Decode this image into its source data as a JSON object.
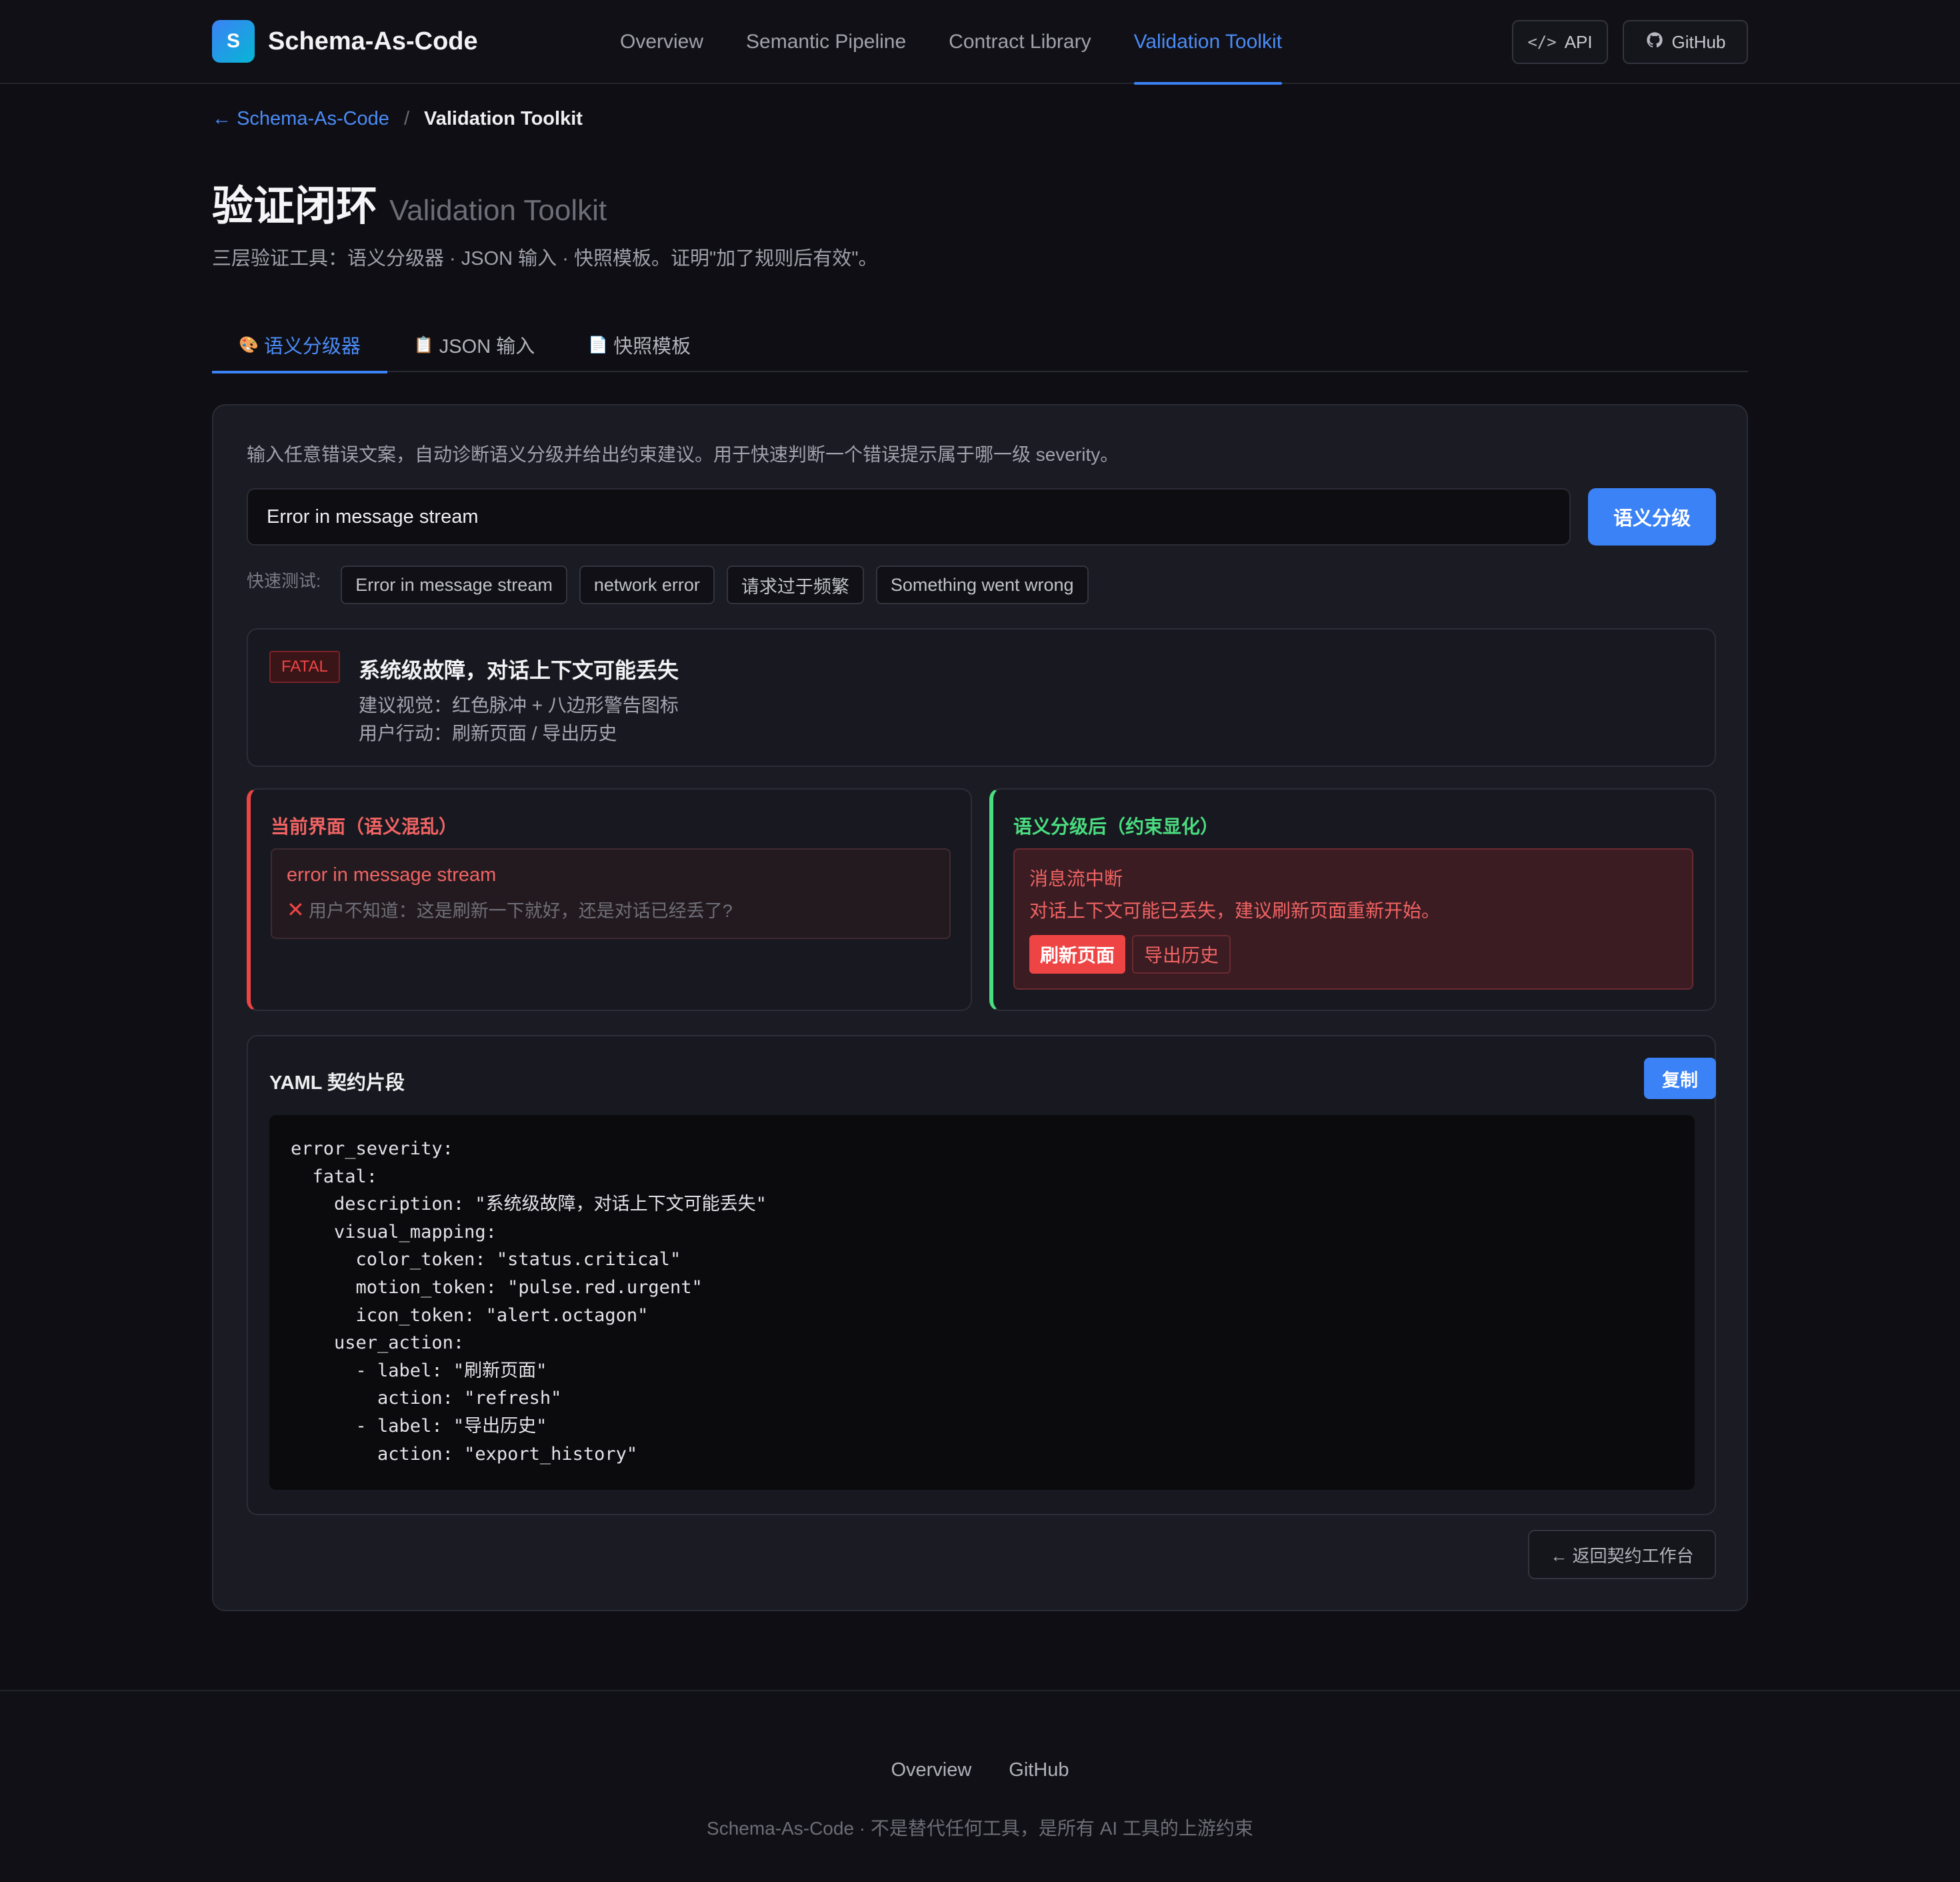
{
  "header": {
    "logo_letter": "S",
    "brand": "Schema-As-Code",
    "nav": [
      "Overview",
      "Semantic Pipeline",
      "Contract Library",
      "Validation Toolkit"
    ],
    "active_nav": "Validation Toolkit",
    "api_label": "API",
    "github_label": "GitHub",
    "api_icon": "code-icon",
    "github_icon": "github-icon"
  },
  "breadcrumb": {
    "back_arrow": "←",
    "back_label": "Schema-As-Code",
    "separator": "/",
    "current": "Validation Toolkit"
  },
  "page": {
    "title_zh": "验证闭环",
    "title_en": "Validation Toolkit",
    "subtitle": "三层验证工具：语义分级器 · JSON 输入 · 快照模板。证明\"加了规则后有效\"。"
  },
  "tabs": [
    {
      "icon": "🎨",
      "label": "语义分级器"
    },
    {
      "icon": "📋",
      "label": "JSON 输入"
    },
    {
      "icon": "📄",
      "label": "快照模板"
    }
  ],
  "classifier": {
    "description": "输入任意错误文案，自动诊断语义分级并给出约束建议。用于快速判断一个错误提示属于哪一级 severity。",
    "input_value": "Error in message stream",
    "submit_label": "语义分级",
    "quick_label": "快速测试:",
    "quick_tests": [
      "Error in message stream",
      "network error",
      "请求过于频繁",
      "Something went wrong"
    ]
  },
  "result": {
    "badge": "FATAL",
    "title": "系统级故障，对话上下文可能丢失",
    "visual": "建议视觉：红色脉冲 + 八边形警告图标",
    "action": "用户行动：刷新页面 / 导出历史"
  },
  "compare": {
    "before_title": "当前界面（语义混乱）",
    "before_error": "error in message stream",
    "before_mark": "✕",
    "before_note": "用户不知道：这是刷新一下就好，还是对话已经丢了?",
    "after_title": "语义分级后（约束显化）",
    "after_heading": "消息流中断",
    "after_desc": "对话上下文可能已丢失，建议刷新页面重新开始。",
    "after_btn_primary": "刷新页面",
    "after_btn_secondary": "导出历史"
  },
  "yaml": {
    "title": "YAML 契约片段",
    "copy_label": "复制",
    "lines": [
      "error_severity:",
      "  fatal:",
      "    description: \"系统级故障，对话上下文可能丢失\"",
      "    visual_mapping:",
      "      color_token: \"status.critical\"",
      "      motion_token: \"pulse.red.urgent\"",
      "      icon_token: \"alert.octagon\"",
      "    user_action:",
      "      - label: \"刷新页面\"",
      "        action: \"refresh\"",
      "      - label: \"导出历史\"",
      "        action: \"export_history\""
    ]
  },
  "back_button": "← 返回契约工作台",
  "footer": {
    "links": [
      "Overview",
      "GitHub"
    ],
    "note": "Schema-As-Code · 不是替代任何工具，是所有 AI 工具的上游约束"
  },
  "colors": {
    "accent": "#3b82f6",
    "fatal": "#ef4444",
    "success": "#4ade80",
    "background": "#0e0e14"
  }
}
